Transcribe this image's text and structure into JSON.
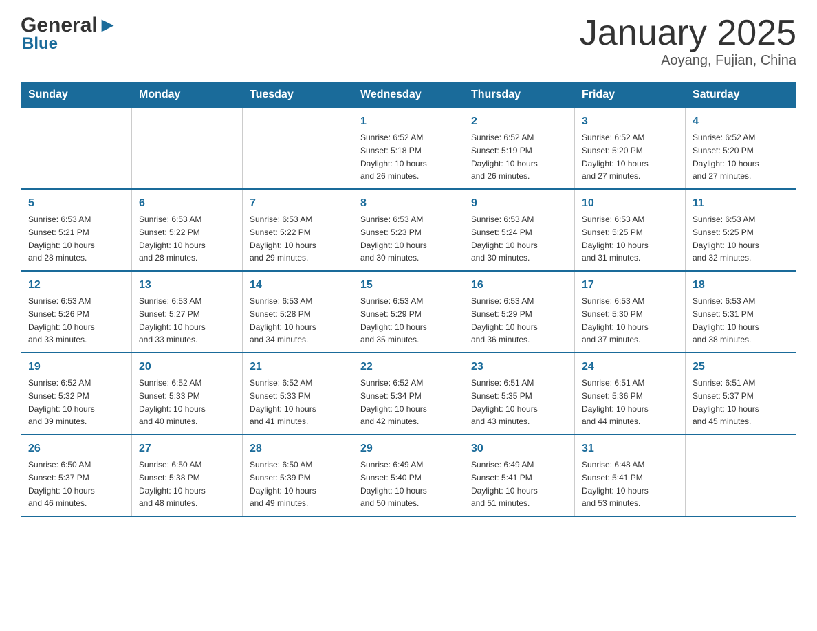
{
  "header": {
    "logo_general": "General",
    "logo_blue": "Blue",
    "month_title": "January 2025",
    "location": "Aoyang, Fujian, China"
  },
  "weekdays": [
    "Sunday",
    "Monday",
    "Tuesday",
    "Wednesday",
    "Thursday",
    "Friday",
    "Saturday"
  ],
  "weeks": [
    [
      {
        "day": "",
        "info": ""
      },
      {
        "day": "",
        "info": ""
      },
      {
        "day": "",
        "info": ""
      },
      {
        "day": "1",
        "info": "Sunrise: 6:52 AM\nSunset: 5:18 PM\nDaylight: 10 hours\nand 26 minutes."
      },
      {
        "day": "2",
        "info": "Sunrise: 6:52 AM\nSunset: 5:19 PM\nDaylight: 10 hours\nand 26 minutes."
      },
      {
        "day": "3",
        "info": "Sunrise: 6:52 AM\nSunset: 5:20 PM\nDaylight: 10 hours\nand 27 minutes."
      },
      {
        "day": "4",
        "info": "Sunrise: 6:52 AM\nSunset: 5:20 PM\nDaylight: 10 hours\nand 27 minutes."
      }
    ],
    [
      {
        "day": "5",
        "info": "Sunrise: 6:53 AM\nSunset: 5:21 PM\nDaylight: 10 hours\nand 28 minutes."
      },
      {
        "day": "6",
        "info": "Sunrise: 6:53 AM\nSunset: 5:22 PM\nDaylight: 10 hours\nand 28 minutes."
      },
      {
        "day": "7",
        "info": "Sunrise: 6:53 AM\nSunset: 5:22 PM\nDaylight: 10 hours\nand 29 minutes."
      },
      {
        "day": "8",
        "info": "Sunrise: 6:53 AM\nSunset: 5:23 PM\nDaylight: 10 hours\nand 30 minutes."
      },
      {
        "day": "9",
        "info": "Sunrise: 6:53 AM\nSunset: 5:24 PM\nDaylight: 10 hours\nand 30 minutes."
      },
      {
        "day": "10",
        "info": "Sunrise: 6:53 AM\nSunset: 5:25 PM\nDaylight: 10 hours\nand 31 minutes."
      },
      {
        "day": "11",
        "info": "Sunrise: 6:53 AM\nSunset: 5:25 PM\nDaylight: 10 hours\nand 32 minutes."
      }
    ],
    [
      {
        "day": "12",
        "info": "Sunrise: 6:53 AM\nSunset: 5:26 PM\nDaylight: 10 hours\nand 33 minutes."
      },
      {
        "day": "13",
        "info": "Sunrise: 6:53 AM\nSunset: 5:27 PM\nDaylight: 10 hours\nand 33 minutes."
      },
      {
        "day": "14",
        "info": "Sunrise: 6:53 AM\nSunset: 5:28 PM\nDaylight: 10 hours\nand 34 minutes."
      },
      {
        "day": "15",
        "info": "Sunrise: 6:53 AM\nSunset: 5:29 PM\nDaylight: 10 hours\nand 35 minutes."
      },
      {
        "day": "16",
        "info": "Sunrise: 6:53 AM\nSunset: 5:29 PM\nDaylight: 10 hours\nand 36 minutes."
      },
      {
        "day": "17",
        "info": "Sunrise: 6:53 AM\nSunset: 5:30 PM\nDaylight: 10 hours\nand 37 minutes."
      },
      {
        "day": "18",
        "info": "Sunrise: 6:53 AM\nSunset: 5:31 PM\nDaylight: 10 hours\nand 38 minutes."
      }
    ],
    [
      {
        "day": "19",
        "info": "Sunrise: 6:52 AM\nSunset: 5:32 PM\nDaylight: 10 hours\nand 39 minutes."
      },
      {
        "day": "20",
        "info": "Sunrise: 6:52 AM\nSunset: 5:33 PM\nDaylight: 10 hours\nand 40 minutes."
      },
      {
        "day": "21",
        "info": "Sunrise: 6:52 AM\nSunset: 5:33 PM\nDaylight: 10 hours\nand 41 minutes."
      },
      {
        "day": "22",
        "info": "Sunrise: 6:52 AM\nSunset: 5:34 PM\nDaylight: 10 hours\nand 42 minutes."
      },
      {
        "day": "23",
        "info": "Sunrise: 6:51 AM\nSunset: 5:35 PM\nDaylight: 10 hours\nand 43 minutes."
      },
      {
        "day": "24",
        "info": "Sunrise: 6:51 AM\nSunset: 5:36 PM\nDaylight: 10 hours\nand 44 minutes."
      },
      {
        "day": "25",
        "info": "Sunrise: 6:51 AM\nSunset: 5:37 PM\nDaylight: 10 hours\nand 45 minutes."
      }
    ],
    [
      {
        "day": "26",
        "info": "Sunrise: 6:50 AM\nSunset: 5:37 PM\nDaylight: 10 hours\nand 46 minutes."
      },
      {
        "day": "27",
        "info": "Sunrise: 6:50 AM\nSunset: 5:38 PM\nDaylight: 10 hours\nand 48 minutes."
      },
      {
        "day": "28",
        "info": "Sunrise: 6:50 AM\nSunset: 5:39 PM\nDaylight: 10 hours\nand 49 minutes."
      },
      {
        "day": "29",
        "info": "Sunrise: 6:49 AM\nSunset: 5:40 PM\nDaylight: 10 hours\nand 50 minutes."
      },
      {
        "day": "30",
        "info": "Sunrise: 6:49 AM\nSunset: 5:41 PM\nDaylight: 10 hours\nand 51 minutes."
      },
      {
        "day": "31",
        "info": "Sunrise: 6:48 AM\nSunset: 5:41 PM\nDaylight: 10 hours\nand 53 minutes."
      },
      {
        "day": "",
        "info": ""
      }
    ]
  ]
}
